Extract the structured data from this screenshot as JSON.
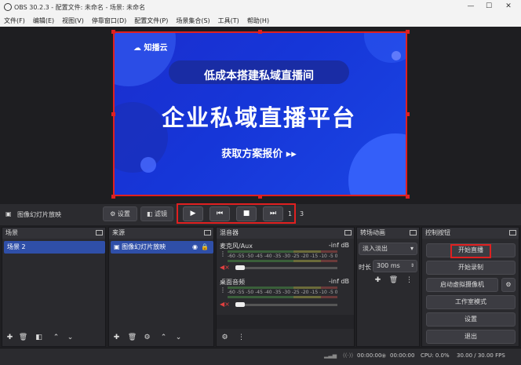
{
  "window": {
    "title": "OBS 30.2.3 - 配置文件: 未命名 - 场景: 未命名",
    "minimize": "—",
    "maximize": "☐",
    "close": "✕"
  },
  "menu": [
    "文件(F)",
    "编辑(E)",
    "视图(V)",
    "停靠窗口(D)",
    "配置文件(P)",
    "场景集合(S)",
    "工具(T)",
    "帮助(H)"
  ],
  "banner": {
    "logo": "知播云",
    "subtitle": "低成本搭建私域直播间",
    "main": "企业私域直播平台",
    "cta": "获取方案报价 ▸▸"
  },
  "source_bar": {
    "source_name": "图像幻灯片放映",
    "settings": "⚙ 设置",
    "filters": "滤镜",
    "slide_index": "1",
    "slide_total": "3"
  },
  "media": {
    "play": "▶",
    "prev": "⏮",
    "stop": "■",
    "next": "⏭"
  },
  "scenes": {
    "title": "场景",
    "items": [
      "场景 2"
    ]
  },
  "sources": {
    "title": "来源",
    "items": [
      "图像幻灯片放映"
    ]
  },
  "mixer": {
    "title": "混音器",
    "channels": [
      {
        "name": "麦克风/Aux",
        "level": "-inf dB"
      },
      {
        "name": "桌面音频",
        "level": "-inf dB"
      }
    ],
    "ticks": "-60 -55 -50 -45 -40 -35 -30 -25 -20 -15 -10 -5 0"
  },
  "transitions": {
    "title": "转场动画",
    "selected": "淡入淡出",
    "duration_label": "时长",
    "duration": "300 ms"
  },
  "controls": {
    "title": "控制按钮",
    "start_stream": "开始直播",
    "start_record": "开始录制",
    "virtual_cam": "启动虚拟摄像机",
    "studio_mode": "工作室模式",
    "settings": "设置",
    "exit": "退出"
  },
  "status": {
    "stream_time": "00:00:00",
    "record_time": "00:00:00",
    "cpu": "CPU: 0.0%",
    "fps": "30.00 / 30.00 FPS"
  },
  "colors": {
    "highlight": "#e02020",
    "selected": "#2f4fa8",
    "banner": "#1636d8"
  }
}
